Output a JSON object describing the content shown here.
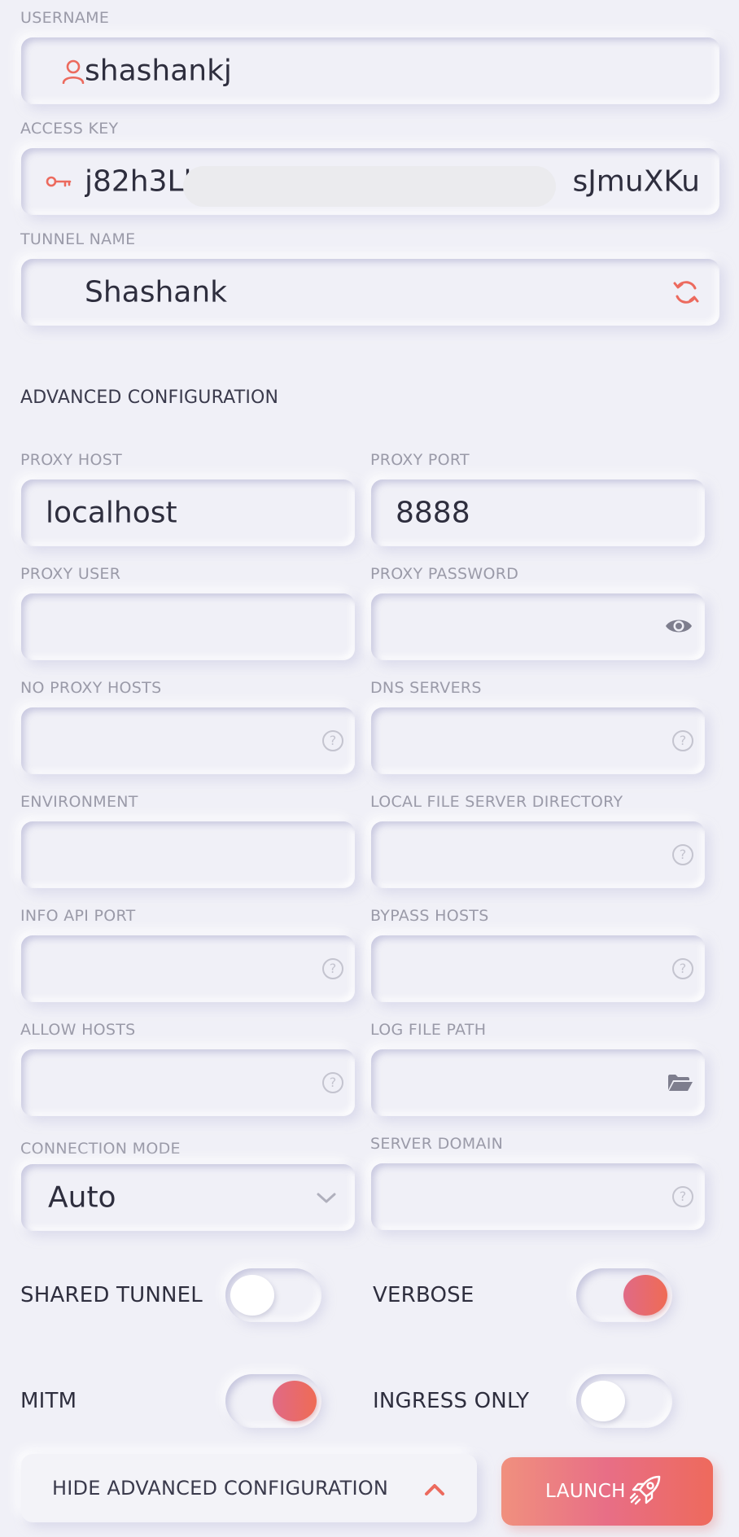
{
  "username": {
    "label": "USERNAME",
    "value": "shashankj",
    "icon": "user-icon"
  },
  "access_key": {
    "label": "ACCESS KEY",
    "value_start": "j82h3Lk",
    "value_end": "sJmuXKu",
    "icon": "key-icon"
  },
  "tunnel_name": {
    "label": "TUNNEL NAME",
    "value": "Shashank",
    "icon": "refresh-icon"
  },
  "advanced": {
    "title": "ADVANCED CONFIGURATION"
  },
  "fields": {
    "proxy_host": {
      "label": "PROXY HOST",
      "value": "localhost"
    },
    "proxy_port": {
      "label": "PROXY PORT",
      "value": "8888"
    },
    "proxy_user": {
      "label": "PROXY USER",
      "value": ""
    },
    "proxy_password": {
      "label": "PROXY PASSWORD",
      "value": "",
      "icon": "eye-icon"
    },
    "no_proxy_hosts": {
      "label": "NO PROXY HOSTS",
      "value": "",
      "icon": "help-icon"
    },
    "dns_servers": {
      "label": "DNS SERVERS",
      "value": "",
      "icon": "help-icon"
    },
    "environment": {
      "label": "ENVIRONMENT",
      "value": ""
    },
    "local_file_server_directory": {
      "label": "LOCAL FILE SERVER DIRECTORY",
      "value": "",
      "icon": "help-icon"
    },
    "info_api_port": {
      "label": "INFO API PORT",
      "value": "",
      "icon": "help-icon"
    },
    "bypass_hosts": {
      "label": "BYPASS HOSTS",
      "value": "",
      "icon": "help-icon"
    },
    "allow_hosts": {
      "label": "ALLOW HOSTS",
      "value": "",
      "icon": "help-icon"
    },
    "log_file_path": {
      "label": "LOG FILE PATH",
      "value": "",
      "icon": "folder-open-icon"
    },
    "connection_mode": {
      "label": "CONNECTION MODE",
      "value": "Auto",
      "icon": "chevron-down-icon"
    },
    "server_domain": {
      "label": "SERVER DOMAIN",
      "value": "",
      "icon": "help-icon"
    }
  },
  "help_glyph": "?",
  "toggles": {
    "shared_tunnel": {
      "label": "SHARED TUNNEL",
      "on": false
    },
    "verbose": {
      "label": "VERBOSE",
      "on": true
    },
    "mitm": {
      "label": "MITM",
      "on": true
    },
    "ingress_only": {
      "label": "INGRESS ONLY",
      "on": false
    }
  },
  "buttons": {
    "hide_advanced": "HIDE ADVANCED CONFIGURATION",
    "launch": "LAUNCH"
  },
  "colors": {
    "accent": "#ec6a5e",
    "background": "#f0f0f7",
    "toggle_on_gradient_start": "#e06a86",
    "toggle_on_gradient_end": "#ef6b55"
  }
}
